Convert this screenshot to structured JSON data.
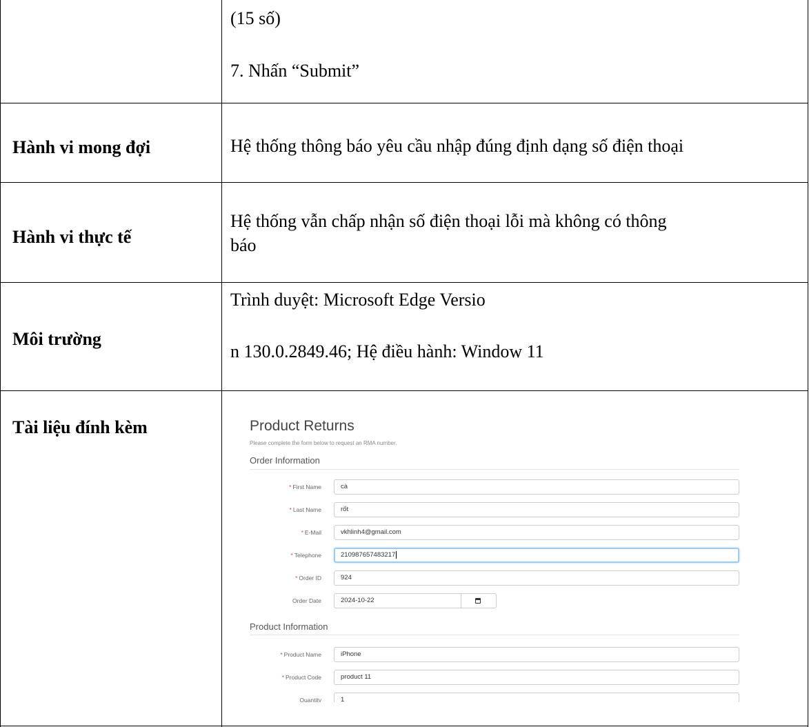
{
  "rows": {
    "steps_cont": {
      "line1": "(15 số)",
      "line2": "7. Nhấn “Submit”"
    },
    "expected": {
      "label": "Hành vi mong đợi",
      "value": "Hệ thống thông báo yêu cầu nhập đúng định dạng số điện thoại"
    },
    "actual": {
      "label": "Hành vi thực tế",
      "value_line1": "Hệ thống vẫn chấp nhận số điện thoại lỗi mà không có thông",
      "value_line2": "báo"
    },
    "environment": {
      "label": "Môi trường",
      "value_line1": "Trình duyệt: Microsoft Edge Versio",
      "value_line2": "n 130.0.2849.46; Hệ điều hành: Window 11"
    },
    "attachment": {
      "label": "Tài liệu đính kèm"
    }
  },
  "screenshot": {
    "title": "Product Returns",
    "subtitle": "Please complete the form below to request an RMA number.",
    "order_section": "Order Information",
    "product_section": "Product Information",
    "fields": {
      "first_name": {
        "label": "First Name",
        "value": "cà"
      },
      "last_name": {
        "label": "Last Name",
        "value": "rốt"
      },
      "email": {
        "label": "E-Mail",
        "value": "vkhlinh4@gmail.com"
      },
      "telephone": {
        "label": "Telephone",
        "value": "210987657483217"
      },
      "order_id": {
        "label": "Order ID",
        "value": "924"
      },
      "order_date": {
        "label": "Order Date",
        "value": "2024-10-22"
      },
      "product_name": {
        "label": "Product Name",
        "value": "iPhone"
      },
      "product_code": {
        "label": "Product Code",
        "value": "product 11"
      },
      "quantity": {
        "label": "Quantity",
        "value": "1"
      }
    },
    "required_mark": "*",
    "colors": {
      "required": "#e04b4b",
      "focus_border": "#9ecaed"
    }
  }
}
